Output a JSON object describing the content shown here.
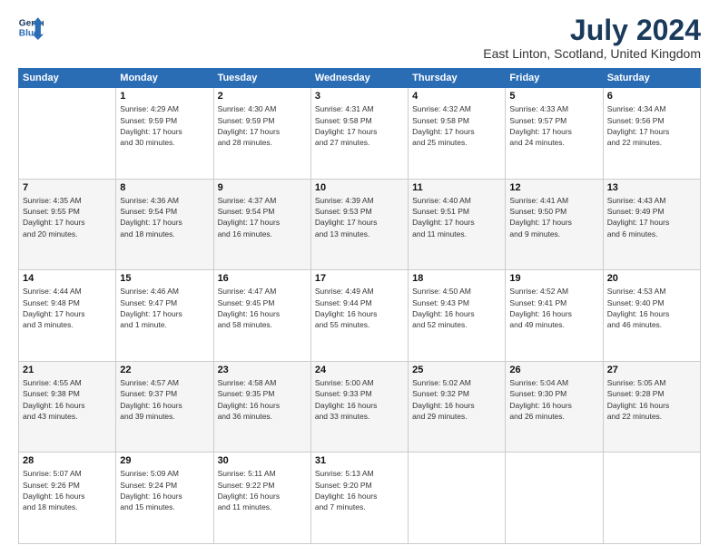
{
  "header": {
    "logo_line1": "General",
    "logo_line2": "Blue",
    "title": "July 2024",
    "subtitle": "East Linton, Scotland, United Kingdom"
  },
  "weekdays": [
    "Sunday",
    "Monday",
    "Tuesday",
    "Wednesday",
    "Thursday",
    "Friday",
    "Saturday"
  ],
  "rows": [
    [
      {
        "day": "",
        "lines": []
      },
      {
        "day": "1",
        "lines": [
          "Sunrise: 4:29 AM",
          "Sunset: 9:59 PM",
          "Daylight: 17 hours",
          "and 30 minutes."
        ]
      },
      {
        "day": "2",
        "lines": [
          "Sunrise: 4:30 AM",
          "Sunset: 9:59 PM",
          "Daylight: 17 hours",
          "and 28 minutes."
        ]
      },
      {
        "day": "3",
        "lines": [
          "Sunrise: 4:31 AM",
          "Sunset: 9:58 PM",
          "Daylight: 17 hours",
          "and 27 minutes."
        ]
      },
      {
        "day": "4",
        "lines": [
          "Sunrise: 4:32 AM",
          "Sunset: 9:58 PM",
          "Daylight: 17 hours",
          "and 25 minutes."
        ]
      },
      {
        "day": "5",
        "lines": [
          "Sunrise: 4:33 AM",
          "Sunset: 9:57 PM",
          "Daylight: 17 hours",
          "and 24 minutes."
        ]
      },
      {
        "day": "6",
        "lines": [
          "Sunrise: 4:34 AM",
          "Sunset: 9:56 PM",
          "Daylight: 17 hours",
          "and 22 minutes."
        ]
      }
    ],
    [
      {
        "day": "7",
        "lines": [
          "Sunrise: 4:35 AM",
          "Sunset: 9:55 PM",
          "Daylight: 17 hours",
          "and 20 minutes."
        ]
      },
      {
        "day": "8",
        "lines": [
          "Sunrise: 4:36 AM",
          "Sunset: 9:54 PM",
          "Daylight: 17 hours",
          "and 18 minutes."
        ]
      },
      {
        "day": "9",
        "lines": [
          "Sunrise: 4:37 AM",
          "Sunset: 9:54 PM",
          "Daylight: 17 hours",
          "and 16 minutes."
        ]
      },
      {
        "day": "10",
        "lines": [
          "Sunrise: 4:39 AM",
          "Sunset: 9:53 PM",
          "Daylight: 17 hours",
          "and 13 minutes."
        ]
      },
      {
        "day": "11",
        "lines": [
          "Sunrise: 4:40 AM",
          "Sunset: 9:51 PM",
          "Daylight: 17 hours",
          "and 11 minutes."
        ]
      },
      {
        "day": "12",
        "lines": [
          "Sunrise: 4:41 AM",
          "Sunset: 9:50 PM",
          "Daylight: 17 hours",
          "and 9 minutes."
        ]
      },
      {
        "day": "13",
        "lines": [
          "Sunrise: 4:43 AM",
          "Sunset: 9:49 PM",
          "Daylight: 17 hours",
          "and 6 minutes."
        ]
      }
    ],
    [
      {
        "day": "14",
        "lines": [
          "Sunrise: 4:44 AM",
          "Sunset: 9:48 PM",
          "Daylight: 17 hours",
          "and 3 minutes."
        ]
      },
      {
        "day": "15",
        "lines": [
          "Sunrise: 4:46 AM",
          "Sunset: 9:47 PM",
          "Daylight: 17 hours",
          "and 1 minute."
        ]
      },
      {
        "day": "16",
        "lines": [
          "Sunrise: 4:47 AM",
          "Sunset: 9:45 PM",
          "Daylight: 16 hours",
          "and 58 minutes."
        ]
      },
      {
        "day": "17",
        "lines": [
          "Sunrise: 4:49 AM",
          "Sunset: 9:44 PM",
          "Daylight: 16 hours",
          "and 55 minutes."
        ]
      },
      {
        "day": "18",
        "lines": [
          "Sunrise: 4:50 AM",
          "Sunset: 9:43 PM",
          "Daylight: 16 hours",
          "and 52 minutes."
        ]
      },
      {
        "day": "19",
        "lines": [
          "Sunrise: 4:52 AM",
          "Sunset: 9:41 PM",
          "Daylight: 16 hours",
          "and 49 minutes."
        ]
      },
      {
        "day": "20",
        "lines": [
          "Sunrise: 4:53 AM",
          "Sunset: 9:40 PM",
          "Daylight: 16 hours",
          "and 46 minutes."
        ]
      }
    ],
    [
      {
        "day": "21",
        "lines": [
          "Sunrise: 4:55 AM",
          "Sunset: 9:38 PM",
          "Daylight: 16 hours",
          "and 43 minutes."
        ]
      },
      {
        "day": "22",
        "lines": [
          "Sunrise: 4:57 AM",
          "Sunset: 9:37 PM",
          "Daylight: 16 hours",
          "and 39 minutes."
        ]
      },
      {
        "day": "23",
        "lines": [
          "Sunrise: 4:58 AM",
          "Sunset: 9:35 PM",
          "Daylight: 16 hours",
          "and 36 minutes."
        ]
      },
      {
        "day": "24",
        "lines": [
          "Sunrise: 5:00 AM",
          "Sunset: 9:33 PM",
          "Daylight: 16 hours",
          "and 33 minutes."
        ]
      },
      {
        "day": "25",
        "lines": [
          "Sunrise: 5:02 AM",
          "Sunset: 9:32 PM",
          "Daylight: 16 hours",
          "and 29 minutes."
        ]
      },
      {
        "day": "26",
        "lines": [
          "Sunrise: 5:04 AM",
          "Sunset: 9:30 PM",
          "Daylight: 16 hours",
          "and 26 minutes."
        ]
      },
      {
        "day": "27",
        "lines": [
          "Sunrise: 5:05 AM",
          "Sunset: 9:28 PM",
          "Daylight: 16 hours",
          "and 22 minutes."
        ]
      }
    ],
    [
      {
        "day": "28",
        "lines": [
          "Sunrise: 5:07 AM",
          "Sunset: 9:26 PM",
          "Daylight: 16 hours",
          "and 18 minutes."
        ]
      },
      {
        "day": "29",
        "lines": [
          "Sunrise: 5:09 AM",
          "Sunset: 9:24 PM",
          "Daylight: 16 hours",
          "and 15 minutes."
        ]
      },
      {
        "day": "30",
        "lines": [
          "Sunrise: 5:11 AM",
          "Sunset: 9:22 PM",
          "Daylight: 16 hours",
          "and 11 minutes."
        ]
      },
      {
        "day": "31",
        "lines": [
          "Sunrise: 5:13 AM",
          "Sunset: 9:20 PM",
          "Daylight: 16 hours",
          "and 7 minutes."
        ]
      },
      {
        "day": "",
        "lines": []
      },
      {
        "day": "",
        "lines": []
      },
      {
        "day": "",
        "lines": []
      }
    ]
  ]
}
